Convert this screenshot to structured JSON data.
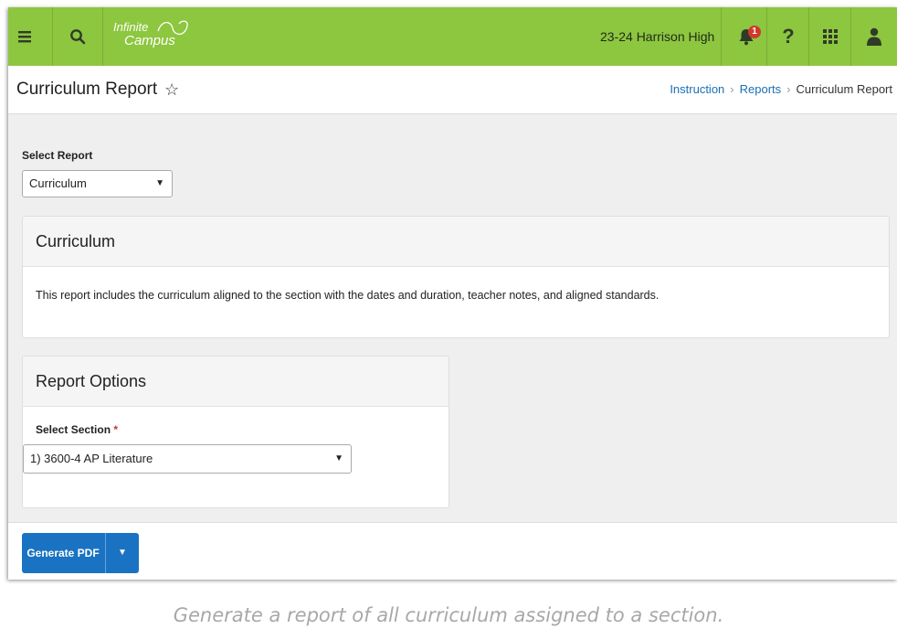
{
  "header": {
    "menu_icon": "hamburger-menu-icon",
    "search_icon": "search-icon",
    "logo_line1": "Infinite",
    "logo_line2": "Campus",
    "school": "23-24 Harrison High",
    "notification_count": "1",
    "help_icon": "question-mark-icon",
    "apps_icon": "app-grid-icon",
    "user_icon": "user-icon",
    "color": "#8dc63f"
  },
  "title_bar": {
    "title": "Curriculum Report",
    "star_icon": "star-outline-icon",
    "breadcrumbs": [
      "Instruction",
      "Reports",
      "Curriculum Report"
    ]
  },
  "form": {
    "select_report_label": "Select Report",
    "select_report_value": "Curriculum"
  },
  "curriculum_panel": {
    "title": "Curriculum",
    "description": "This report includes the curriculum aligned to the section with the dates and duration, teacher notes, and aligned standards."
  },
  "options_panel": {
    "title": "Report Options",
    "select_section_label": "Select Section",
    "required_mark": "*",
    "select_section_value": "1) 3600-4 AP Literature"
  },
  "footer": {
    "generate_label": "Generate PDF",
    "button_color": "#1a73c2"
  },
  "caption": "Generate a report of all curriculum assigned to a section."
}
